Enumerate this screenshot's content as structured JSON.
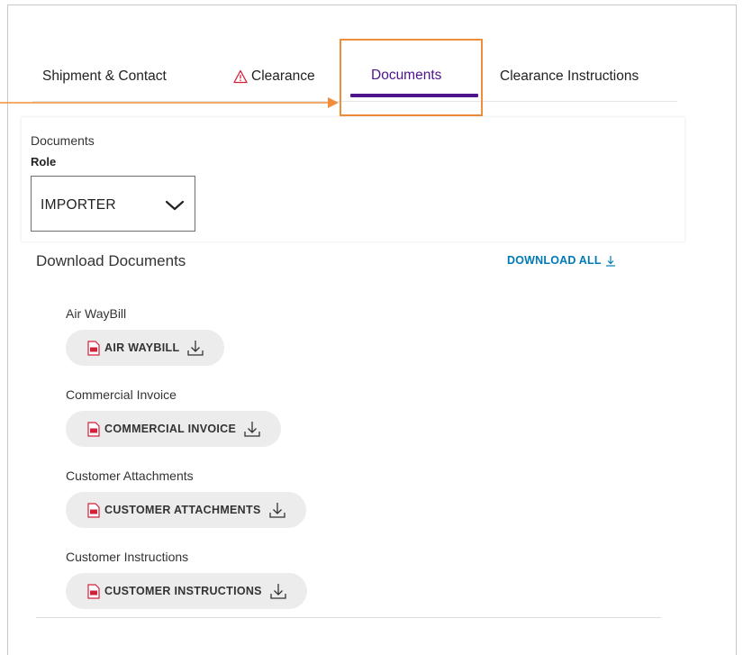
{
  "tabs": [
    {
      "label": "Shipment & Contact"
    },
    {
      "label": "Clearance",
      "icon": "warning-icon",
      "icon_color": "#d1223c"
    },
    {
      "label": "Documents",
      "active": true
    },
    {
      "label": "Clearance Instructions"
    }
  ],
  "colors": {
    "accent": "#4d148c",
    "link": "#007ab7",
    "highlight": "#ef8d3a",
    "pdf": "#d1223c"
  },
  "documents_section": {
    "title": "Documents",
    "role_label": "Role",
    "role_value": "IMPORTER"
  },
  "downloads": {
    "heading": "Download Documents",
    "download_all": "DOWNLOAD ALL",
    "groups": [
      {
        "label": "Air WayBill",
        "button": "AIR WAYBILL"
      },
      {
        "label": "Commercial Invoice",
        "button": "COMMERCIAL INVOICE"
      },
      {
        "label": "Customer Attachments",
        "button": "CUSTOMER ATTACHMENTS"
      },
      {
        "label": "Customer Instructions",
        "button": "CUSTOMER INSTRUCTIONS"
      }
    ]
  }
}
